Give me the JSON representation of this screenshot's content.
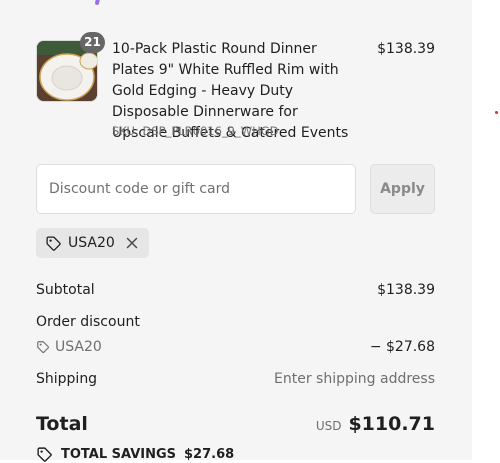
{
  "product": {
    "title": "10-Pack Plastic Round Dinner Plates 9\" White Ruffled Rim with Gold Edging - Heavy Duty Disposable Dinnerware for Upscale Buffets & Catered Events",
    "sku": "SKU: DSP_PLR0016_9_WHGD",
    "price": "$138.39",
    "quantity": "21",
    "image_icon": "plate-product-image"
  },
  "discount": {
    "placeholder": "Discount code or gift card",
    "value": "",
    "apply_label": "Apply"
  },
  "applied_code": {
    "code": "USA20",
    "tag_icon": "tag-icon",
    "remove_icon": "close-icon"
  },
  "totals": {
    "subtotal_label": "Subtotal",
    "subtotal_value": "$138.39",
    "order_discount_label": "Order discount",
    "discount_code": "USA20",
    "discount_value": "− $27.68",
    "shipping_label": "Shipping",
    "shipping_value": "Enter shipping address",
    "total_label": "Total",
    "currency": "USD",
    "total_value": "$110.71",
    "savings_label": "TOTAL SAVINGS",
    "savings_value": "$27.68"
  },
  "colors": {
    "panel_bg": "#f5f5f5",
    "badge_bg": "#666666",
    "brand_accent": "#9a6fe0",
    "muted_text": "#707070"
  }
}
